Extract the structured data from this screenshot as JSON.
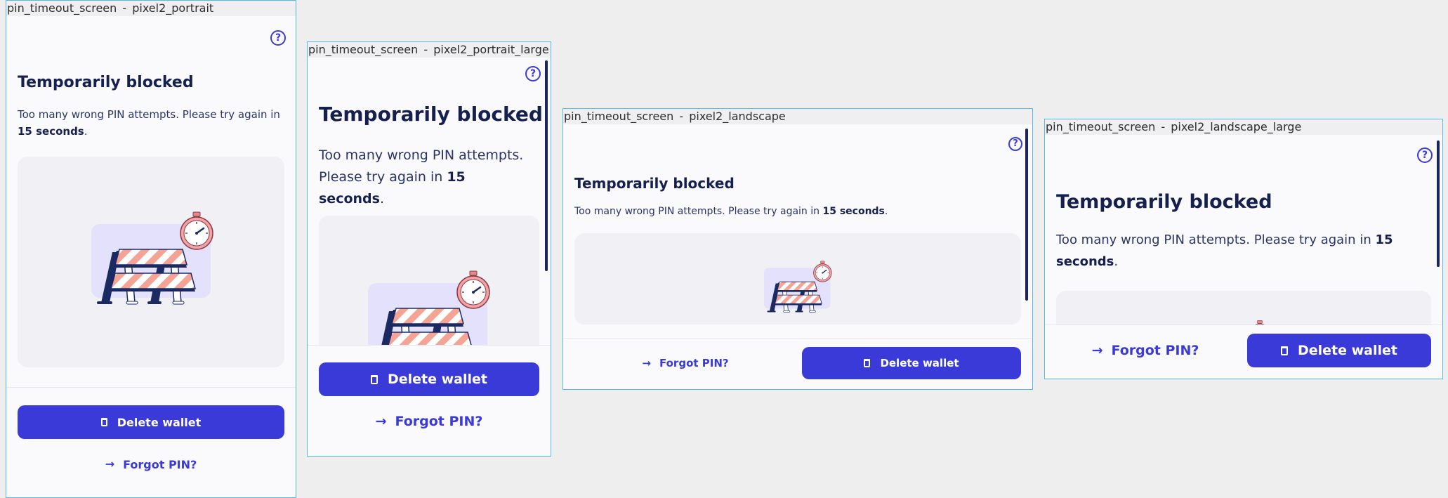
{
  "frames": [
    {
      "label": "pin_timeout_screen - pixel2_portrait",
      "title": "Temporarily blocked",
      "desc_prefix": "Too many wrong PIN attempts. Please try again in ",
      "desc_bold": "15 seconds",
      "desc_suffix": ".",
      "delete_label": "Delete wallet",
      "forgot_label": "Forgot PIN?"
    },
    {
      "label": "pin_timeout_screen - pixel2_portrait_large",
      "title": "Temporarily blocked",
      "desc_prefix": "Too many wrong PIN attempts. Please try again in ",
      "desc_bold": "15 seconds",
      "desc_suffix": ".",
      "delete_label": "Delete wallet",
      "forgot_label": "Forgot PIN?"
    },
    {
      "label": "pin_timeout_screen - pixel2_landscape",
      "title": "Temporarily blocked",
      "desc_prefix": "Too many wrong PIN attempts. Please try again in ",
      "desc_bold": "15 seconds",
      "desc_suffix": ".",
      "delete_label": "Delete wallet",
      "forgot_label": "Forgot PIN?"
    },
    {
      "label": "pin_timeout_screen - pixel2_landscape_large",
      "title": "Temporarily blocked",
      "desc_prefix": "Too many wrong PIN attempts. Please try again in ",
      "desc_bold": "15 seconds",
      "desc_suffix": ".",
      "delete_label": "Delete wallet",
      "forgot_label": "Forgot PIN?"
    }
  ],
  "icons": {
    "help": "help-circle-icon",
    "trash": "trash-icon",
    "arrow": "arrow-right-icon",
    "illustration": "roadblock-stopwatch-illustration"
  },
  "colors": {
    "primary": "#3a3ad8",
    "title": "#16204f",
    "frame_border": "#5bb8e6"
  }
}
